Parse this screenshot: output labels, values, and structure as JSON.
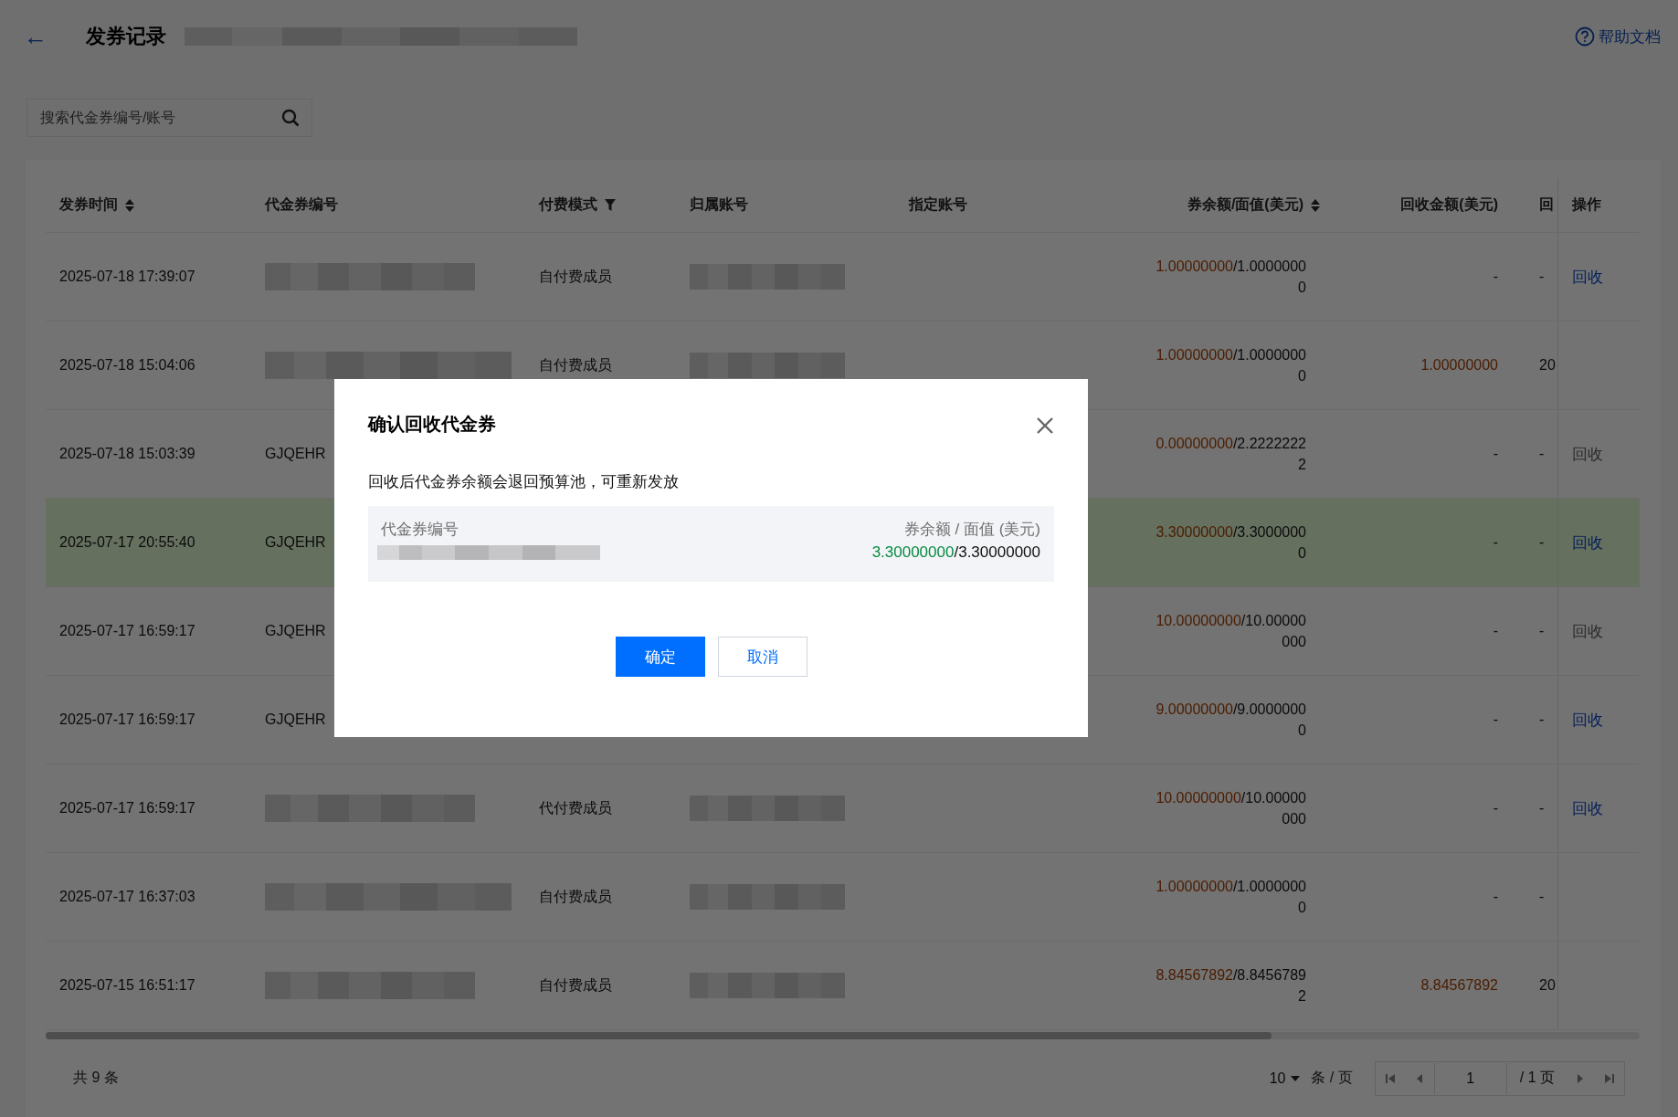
{
  "header": {
    "back": "←",
    "title": "发券记录",
    "title_redacted": true,
    "help": "帮助文档"
  },
  "search": {
    "placeholder": "搜索代金券编号/账号"
  },
  "table": {
    "columns": [
      {
        "label": "发券时间",
        "kind": "sort"
      },
      {
        "label": "代金券编号",
        "kind": "plain"
      },
      {
        "label": "付费模式",
        "kind": "filter"
      },
      {
        "label": "归属账号",
        "kind": "plain"
      },
      {
        "label": "指定账号",
        "kind": "plain"
      },
      {
        "label": "券余额/面值(美元)",
        "kind": "sort"
      },
      {
        "label": "回收金额(美元)",
        "kind": "plain"
      },
      {
        "label": "回",
        "kind": "plain"
      },
      {
        "label": "操作",
        "kind": "plain"
      }
    ],
    "rows": [
      {
        "time": "2025-07-18 17:39:07",
        "pay_mode": "自付费成员",
        "remaining": "1.00000000",
        "face": "/1.00000000",
        "recovered": "-",
        "column_8": "-",
        "action": {
          "label": "回收",
          "disabled": false
        },
        "selected": false
      },
      {
        "time": "2025-07-18 15:04:06",
        "pay_mode": "自付费成员",
        "remaining": "1.00000000",
        "face": "/1.00000000",
        "recovered": "1.00000000",
        "column_8": "20",
        "selected": false
      },
      {
        "time": "2025-07-18 15:03:39",
        "code": "GJQEHR",
        "remaining": "0.00000000",
        "face": "/2.22222222",
        "recovered": "-",
        "column_8": "-",
        "action": {
          "label": "回收",
          "disabled": true
        },
        "selected": false
      },
      {
        "time": "2025-07-17 20:55:40",
        "code": "GJQEHR",
        "remaining": "3.30000000",
        "face": "/3.30000000",
        "recovered": "-",
        "column_8": "-",
        "action": {
          "label": "回收",
          "disabled": false
        },
        "selected": true
      },
      {
        "time": "2025-07-17 16:59:17",
        "code": "GJQEHR",
        "remaining": "10.00000000",
        "face": "/10.00000000",
        "recovered": "-",
        "column_8": "-",
        "action": {
          "label": "回收",
          "disabled": true
        },
        "selected": false
      },
      {
        "time": "2025-07-17 16:59:17",
        "code": "GJQEHR",
        "remaining": "9.00000000",
        "face": "/9.00000000",
        "recovered": "-",
        "column_8": "-",
        "action": {
          "label": "回收",
          "disabled": false
        },
        "selected": false
      },
      {
        "time": "2025-07-17 16:59:17",
        "pay_mode": "代付费成员",
        "remaining": "10.00000000",
        "face": "/10.00000000",
        "recovered": "-",
        "column_8": "-",
        "action": {
          "label": "回收",
          "disabled": false
        },
        "selected": false
      },
      {
        "time": "2025-07-17 16:37:03",
        "pay_mode": "自付费成员",
        "remaining": "1.00000000",
        "face": "/1.00000000",
        "recovered": "-",
        "column_8": "-",
        "selected": false
      },
      {
        "time": "2025-07-15 16:51:17",
        "pay_mode": "自付费成员",
        "remaining": "8.84567892",
        "face": "/8.84567892",
        "recovered": "8.84567892",
        "column_8": "20",
        "selected": false
      }
    ]
  },
  "footer": {
    "total": "共 9 条",
    "page_size": "10",
    "page_size_unit": "条 / 页",
    "page": "1",
    "page_total": "/ 1 页"
  },
  "modal": {
    "title": "确认回收代金券",
    "message": "回收后代金券余额会退回预算池，可重新发放",
    "code_label": "代金券编号",
    "code_redacted": true,
    "balance_label": "券余额 / 面值 (美元)",
    "remaining": "3.30000000",
    "face": "/3.30000000",
    "buttons": [
      {
        "label": "确定",
        "kind": "primary"
      },
      {
        "label": "取消",
        "kind": "secondary"
      }
    ]
  }
}
